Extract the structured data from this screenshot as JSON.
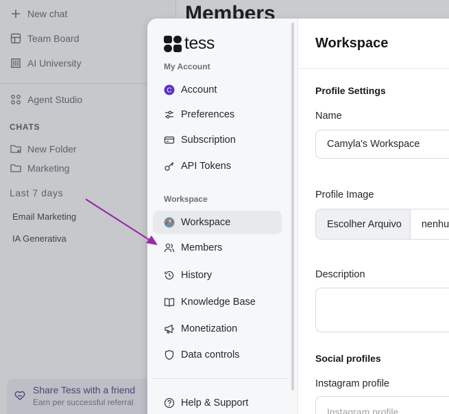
{
  "background": {
    "sidebar": {
      "items": [
        {
          "label": "New chat",
          "icon": "plus-icon"
        },
        {
          "label": "Team Board",
          "icon": "board-icon"
        },
        {
          "label": "AI University",
          "icon": "university-icon"
        },
        {
          "label": "Agent Studio",
          "icon": "grid-icon"
        }
      ],
      "chats_caption": "CHATS",
      "folders": [
        {
          "label": "New Folder",
          "icon": "folder-plus-icon"
        },
        {
          "label": "Marketing",
          "icon": "folder-icon"
        }
      ],
      "last_days": "Last 7 days",
      "chats": [
        "Email Marketing",
        "IA Generativa"
      ],
      "share": {
        "title": "Share Tess with a friend",
        "subtitle": "Earn per successful referral"
      }
    },
    "page_title": "Members"
  },
  "modal": {
    "logo": "tess",
    "account_caption": "My Account",
    "account_items": [
      {
        "label": "Account",
        "icon": "account-avatar-icon"
      },
      {
        "label": "Preferences",
        "icon": "sliders-icon"
      },
      {
        "label": "Subscription",
        "icon": "credit-card-icon"
      },
      {
        "label": "API Tokens",
        "icon": "key-icon"
      }
    ],
    "workspace_caption": "Workspace",
    "workspace_items": [
      {
        "label": "Workspace",
        "icon": "workspace-avatar-icon",
        "active": true
      },
      {
        "label": "Members",
        "icon": "users-icon"
      },
      {
        "label": "History",
        "icon": "history-icon"
      },
      {
        "label": "Knowledge Base",
        "icon": "book-icon"
      },
      {
        "label": "Monetization",
        "icon": "megaphone-icon"
      },
      {
        "label": "Data controls",
        "icon": "shield-icon"
      }
    ],
    "help": {
      "label": "Help & Support",
      "icon": "help-circle-icon"
    },
    "content": {
      "title": "Workspace",
      "profile_settings": "Profile Settings",
      "name_label": "Name",
      "name_value": "Camyla's Workspace",
      "image_label": "Profile Image",
      "file_button": "Escolher Arquivo",
      "file_name": "nenhu",
      "description_label": "Description",
      "social_profiles": "Social profiles",
      "instagram_label": "Instagram profile",
      "instagram_placeholder": "Instagram profile"
    }
  },
  "colors": {
    "arrow": "#9a2aa8",
    "accent": "#5b2fc9",
    "active_nav": "#e8e9ed"
  }
}
